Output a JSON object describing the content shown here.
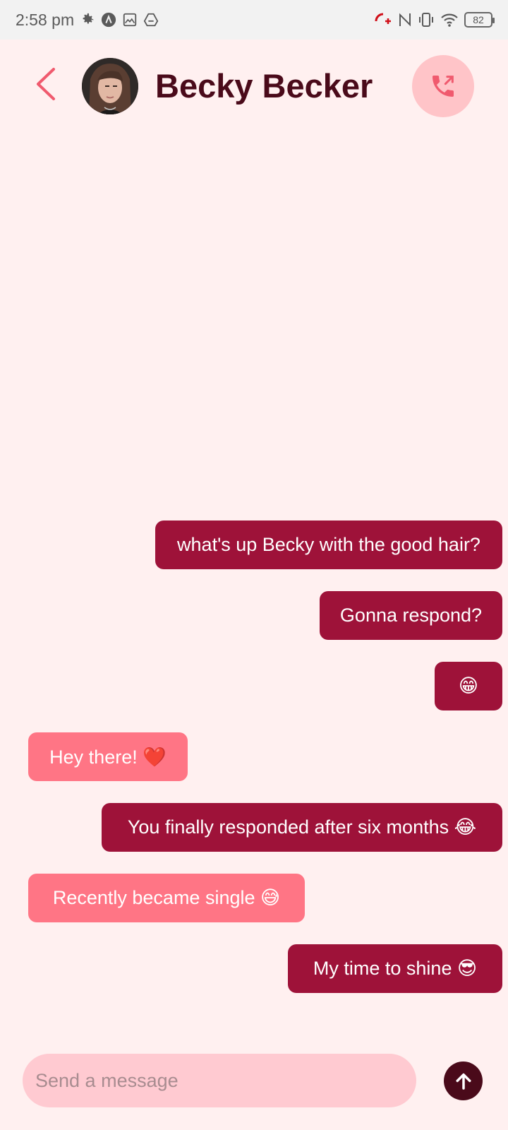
{
  "status_bar": {
    "time": "2:58 pm",
    "battery": "82",
    "icons_left": [
      "settings-icon",
      "nav-app-icon",
      "gallery-icon",
      "drive-icon"
    ],
    "icons_right": [
      "call-forward-icon",
      "nfc-icon",
      "vibrate-icon",
      "wifi-icon",
      "battery-icon"
    ]
  },
  "header": {
    "contact_name": "Becky Becker",
    "back_icon": "chevron-left-icon",
    "call_icon": "outgoing-call-icon"
  },
  "messages": [
    {
      "text": "what's up Becky with the good hair?",
      "direction": "sent"
    },
    {
      "text": "Gonna respond?",
      "direction": "sent"
    },
    {
      "text": "😁",
      "direction": "sent"
    },
    {
      "text": "Hey there! ❤️",
      "direction": "received"
    },
    {
      "text": "You finally responded after six months 😂",
      "direction": "sent"
    },
    {
      "text": "Recently became single 😅",
      "direction": "received"
    },
    {
      "text": "My time to shine 😎",
      "direction": "sent"
    }
  ],
  "composer": {
    "placeholder": "Send a message",
    "value": ""
  },
  "colors": {
    "background": "#fff0f0",
    "sent_bubble": "#9e1239",
    "received_bubble": "#ff7585",
    "title": "#4a0a1a",
    "accent": "#f05a6e",
    "input_bg": "#ffcad1"
  }
}
